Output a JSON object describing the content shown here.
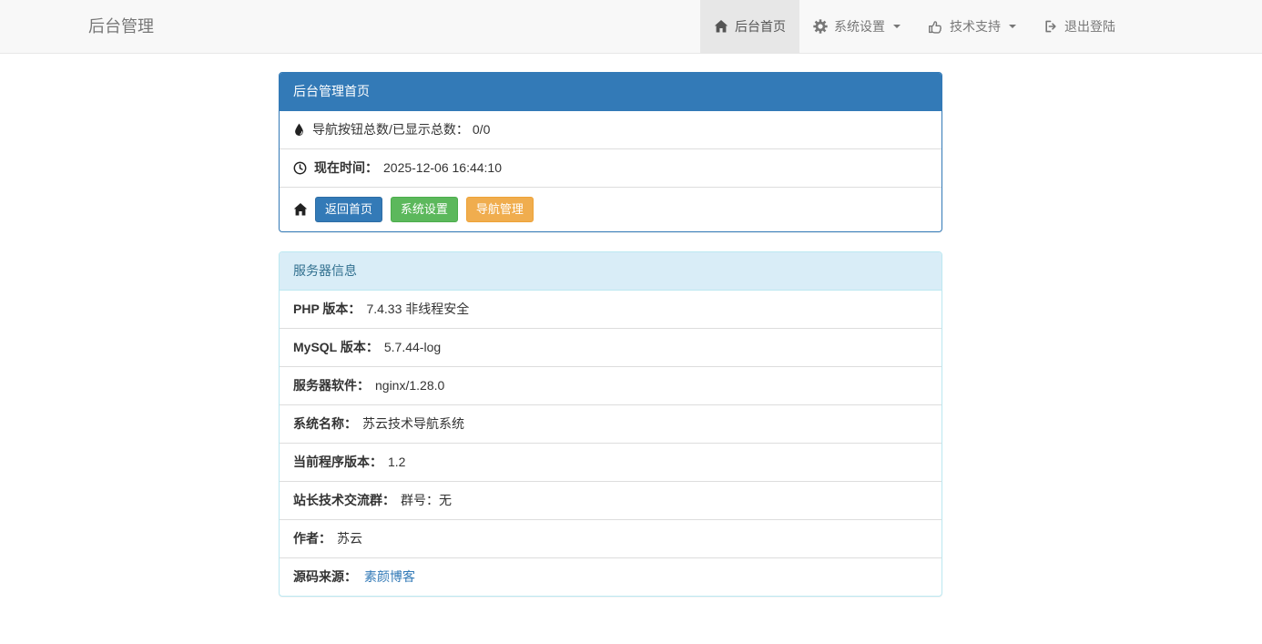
{
  "navbar": {
    "brand": "后台管理",
    "items": [
      {
        "label": "后台首页",
        "icon": "home-icon",
        "active": true,
        "dropdown": false
      },
      {
        "label": "系统设置",
        "icon": "gear-icon",
        "active": false,
        "dropdown": true
      },
      {
        "label": "技术支持",
        "icon": "thumbs-up-icon",
        "active": false,
        "dropdown": true
      },
      {
        "label": "退出登陆",
        "icon": "sign-out-icon",
        "active": false,
        "dropdown": false
      }
    ]
  },
  "home_panel": {
    "title": "后台管理首页",
    "nav_count_label": "导航按钮总数/已显示总数：",
    "nav_count_value": "0/0",
    "time_label": "现在时间：",
    "time_value": "2025-12-06 16:44:10",
    "buttons": [
      {
        "label": "返回首页",
        "color": "#337ab7"
      },
      {
        "label": "系统设置",
        "color": "#5cb85c"
      },
      {
        "label": "导航管理",
        "color": "#f0ad4e"
      }
    ]
  },
  "server_panel": {
    "title": "服务器信息",
    "rows": [
      {
        "label": "PHP 版本：",
        "value": "7.4.33 非线程安全"
      },
      {
        "label": "MySQL 版本：",
        "value": "5.7.44-log"
      },
      {
        "label": "服务器软件：",
        "value": "nginx/1.28.0"
      },
      {
        "label": "系统名称：",
        "value": "苏云技术导航系统"
      },
      {
        "label": "当前程序版本：",
        "value": "1.2"
      },
      {
        "label": "站长技术交流群：",
        "value": "群号：无"
      },
      {
        "label": "作者：",
        "value": "苏云"
      },
      {
        "label": "源码来源：",
        "value": "素颜博客",
        "link": true
      }
    ]
  },
  "colors": {
    "navbar_bg": "#f8f8f8",
    "navbar_active_bg": "#e7e7e7",
    "primary": "#337ab7",
    "success": "#5cb85c",
    "warning": "#f0ad4e",
    "info_header_bg": "#d9edf7",
    "info_header_text": "#31708f",
    "info_border": "#bce8f1",
    "link": "#337ab7"
  }
}
